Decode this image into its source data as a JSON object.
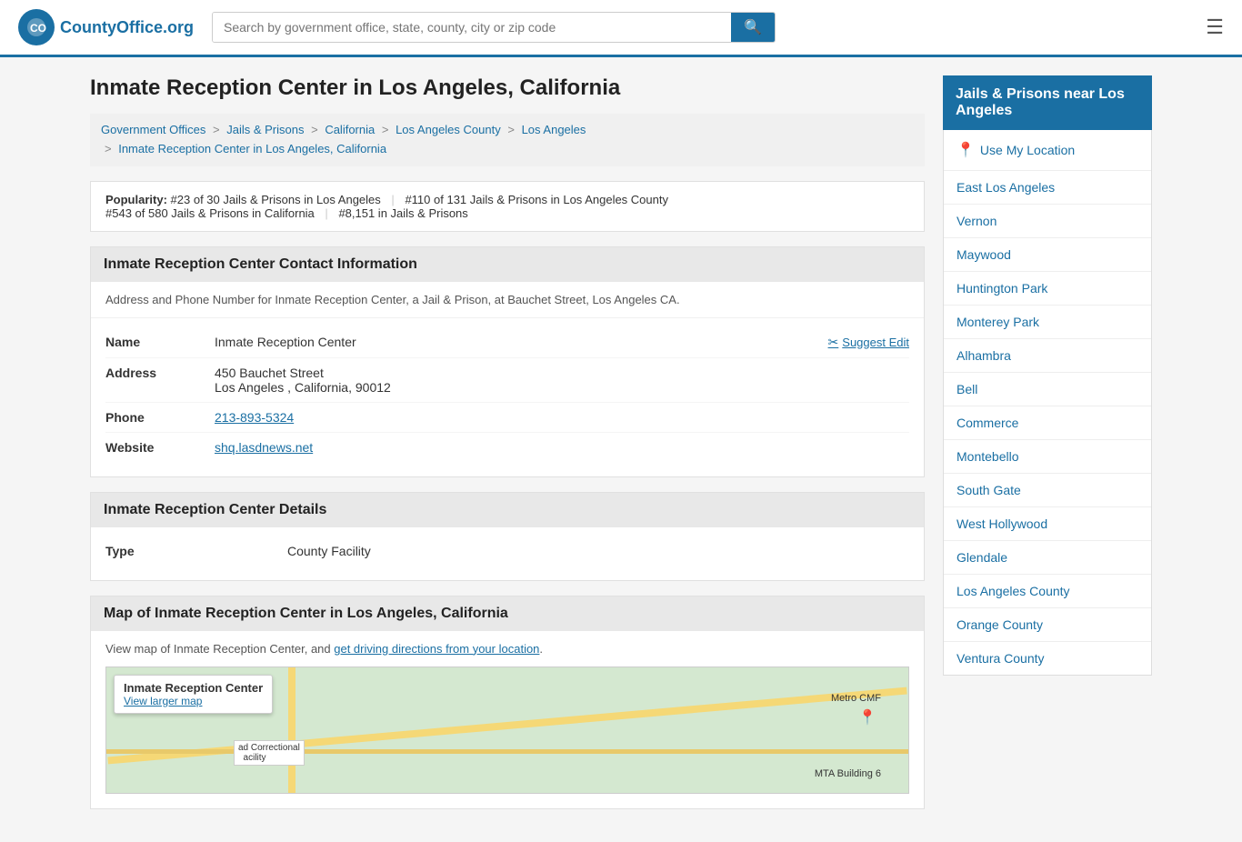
{
  "header": {
    "logo_text": "CountyOffice",
    "logo_suffix": ".org",
    "search_placeholder": "Search by government office, state, county, city or zip code",
    "menu_icon": "☰"
  },
  "page": {
    "title": "Inmate Reception Center in Los Angeles, California"
  },
  "breadcrumb": {
    "items": [
      {
        "label": "Government Offices",
        "href": "#"
      },
      {
        "label": "Jails & Prisons",
        "href": "#"
      },
      {
        "label": "California",
        "href": "#"
      },
      {
        "label": "Los Angeles County",
        "href": "#"
      },
      {
        "label": "Los Angeles",
        "href": "#"
      },
      {
        "label": "Inmate Reception Center in Los Angeles, California",
        "href": "#"
      }
    ]
  },
  "popularity": {
    "label": "Popularity:",
    "items": [
      {
        "text": "#23 of 30 Jails & Prisons in Los Angeles"
      },
      {
        "text": "#110 of 131 Jails & Prisons in Los Angeles County"
      },
      {
        "text": "#543 of 580 Jails & Prisons in California"
      },
      {
        "text": "#8,151 in Jails & Prisons"
      }
    ]
  },
  "contact_section": {
    "header": "Inmate Reception Center Contact Information",
    "description": "Address and Phone Number for Inmate Reception Center, a Jail & Prison, at Bauchet Street, Los Angeles CA.",
    "name_label": "Name",
    "name_value": "Inmate Reception Center",
    "suggest_edit_label": "Suggest Edit",
    "address_label": "Address",
    "address_line1": "450 Bauchet Street",
    "address_line2": "Los Angeles , California, 90012",
    "phone_label": "Phone",
    "phone_value": "213-893-5324",
    "website_label": "Website",
    "website_value": "shq.lasdnews.net"
  },
  "details_section": {
    "header": "Inmate Reception Center Details",
    "type_label": "Type",
    "type_value": "County Facility"
  },
  "map_section": {
    "header": "Map of Inmate Reception Center in Los Angeles, California",
    "description": "View map of Inmate Reception Center, and ",
    "directions_link": "get driving directions from your location",
    "popup_title": "Inmate Reception Center",
    "popup_link": "View larger map",
    "label_metro": "Metro CMF",
    "label_correctional": "ad Correctional\n  acility",
    "label_mta": "MTA Building 6"
  },
  "sidebar": {
    "header": "Jails & Prisons near Los Angeles",
    "use_location": "Use My Location",
    "links": [
      "East Los Angeles",
      "Vernon",
      "Maywood",
      "Huntington Park",
      "Monterey Park",
      "Alhambra",
      "Bell",
      "Commerce",
      "Montebello",
      "South Gate",
      "West Hollywood",
      "Glendale",
      "Los Angeles County",
      "Orange County",
      "Ventura County"
    ]
  }
}
